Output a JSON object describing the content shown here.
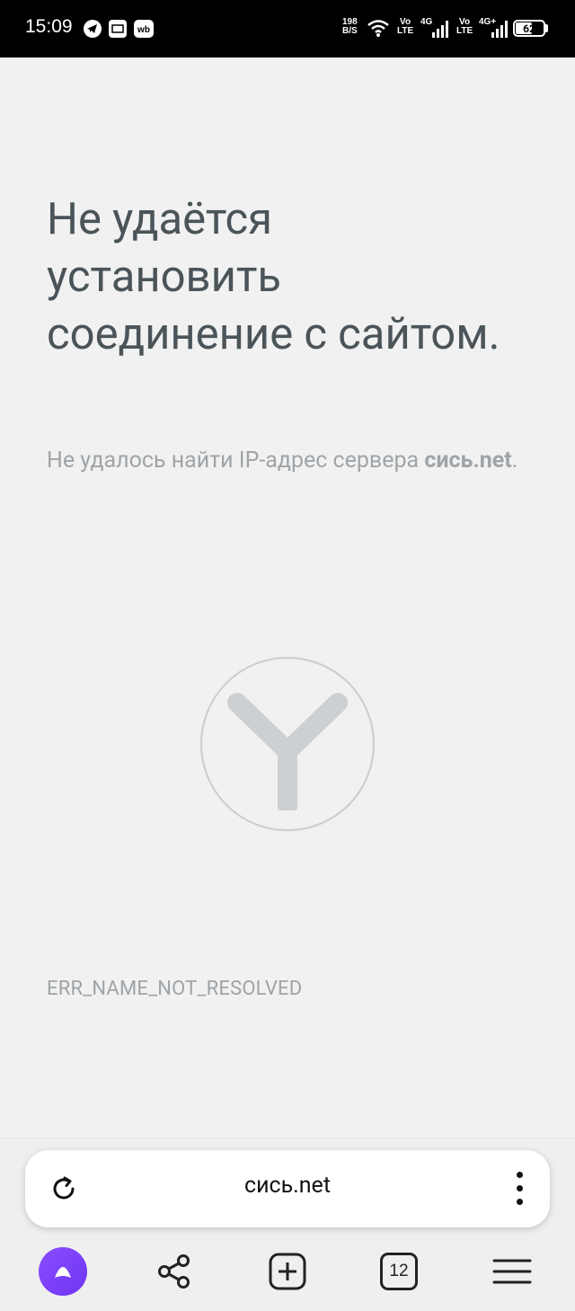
{
  "status_bar": {
    "time": "15:09",
    "net_speed_value": "198",
    "net_speed_unit": "B/S",
    "volte1_top": "Vo",
    "volte1_bottom": "LTE",
    "sim1_type": "4G",
    "volte2_top": "Vo",
    "volte2_bottom": "LTE",
    "sim2_type": "4G+",
    "battery": "62",
    "battery_level_percent": 62,
    "app_icons": [
      "telegram-icon",
      "news-icon",
      "wb-icon"
    ]
  },
  "error_page": {
    "title": "Не удаётся установить соединение с сайтом.",
    "description_prefix": "Не удалось найти IP-адрес сервера ",
    "host": "сись.net",
    "description_suffix": ".",
    "error_code": "ERR_NAME_NOT_RESOLVED",
    "logo": "yandex-browser-logo"
  },
  "address_bar": {
    "url": "сись.net",
    "reload_icon": "reload-icon",
    "menu_icon": "kebab-menu-icon"
  },
  "bottom_nav": {
    "tabs_count": "12",
    "items": [
      "alice-icon",
      "share-icon",
      "new-tab-icon",
      "tabs-icon",
      "hamburger-menu-icon"
    ]
  },
  "colors": {
    "background": "#f1f1f1",
    "title_text": "#4a5459",
    "muted_text": "#9fa4a8",
    "alice_purple": "#7a3ff7"
  }
}
